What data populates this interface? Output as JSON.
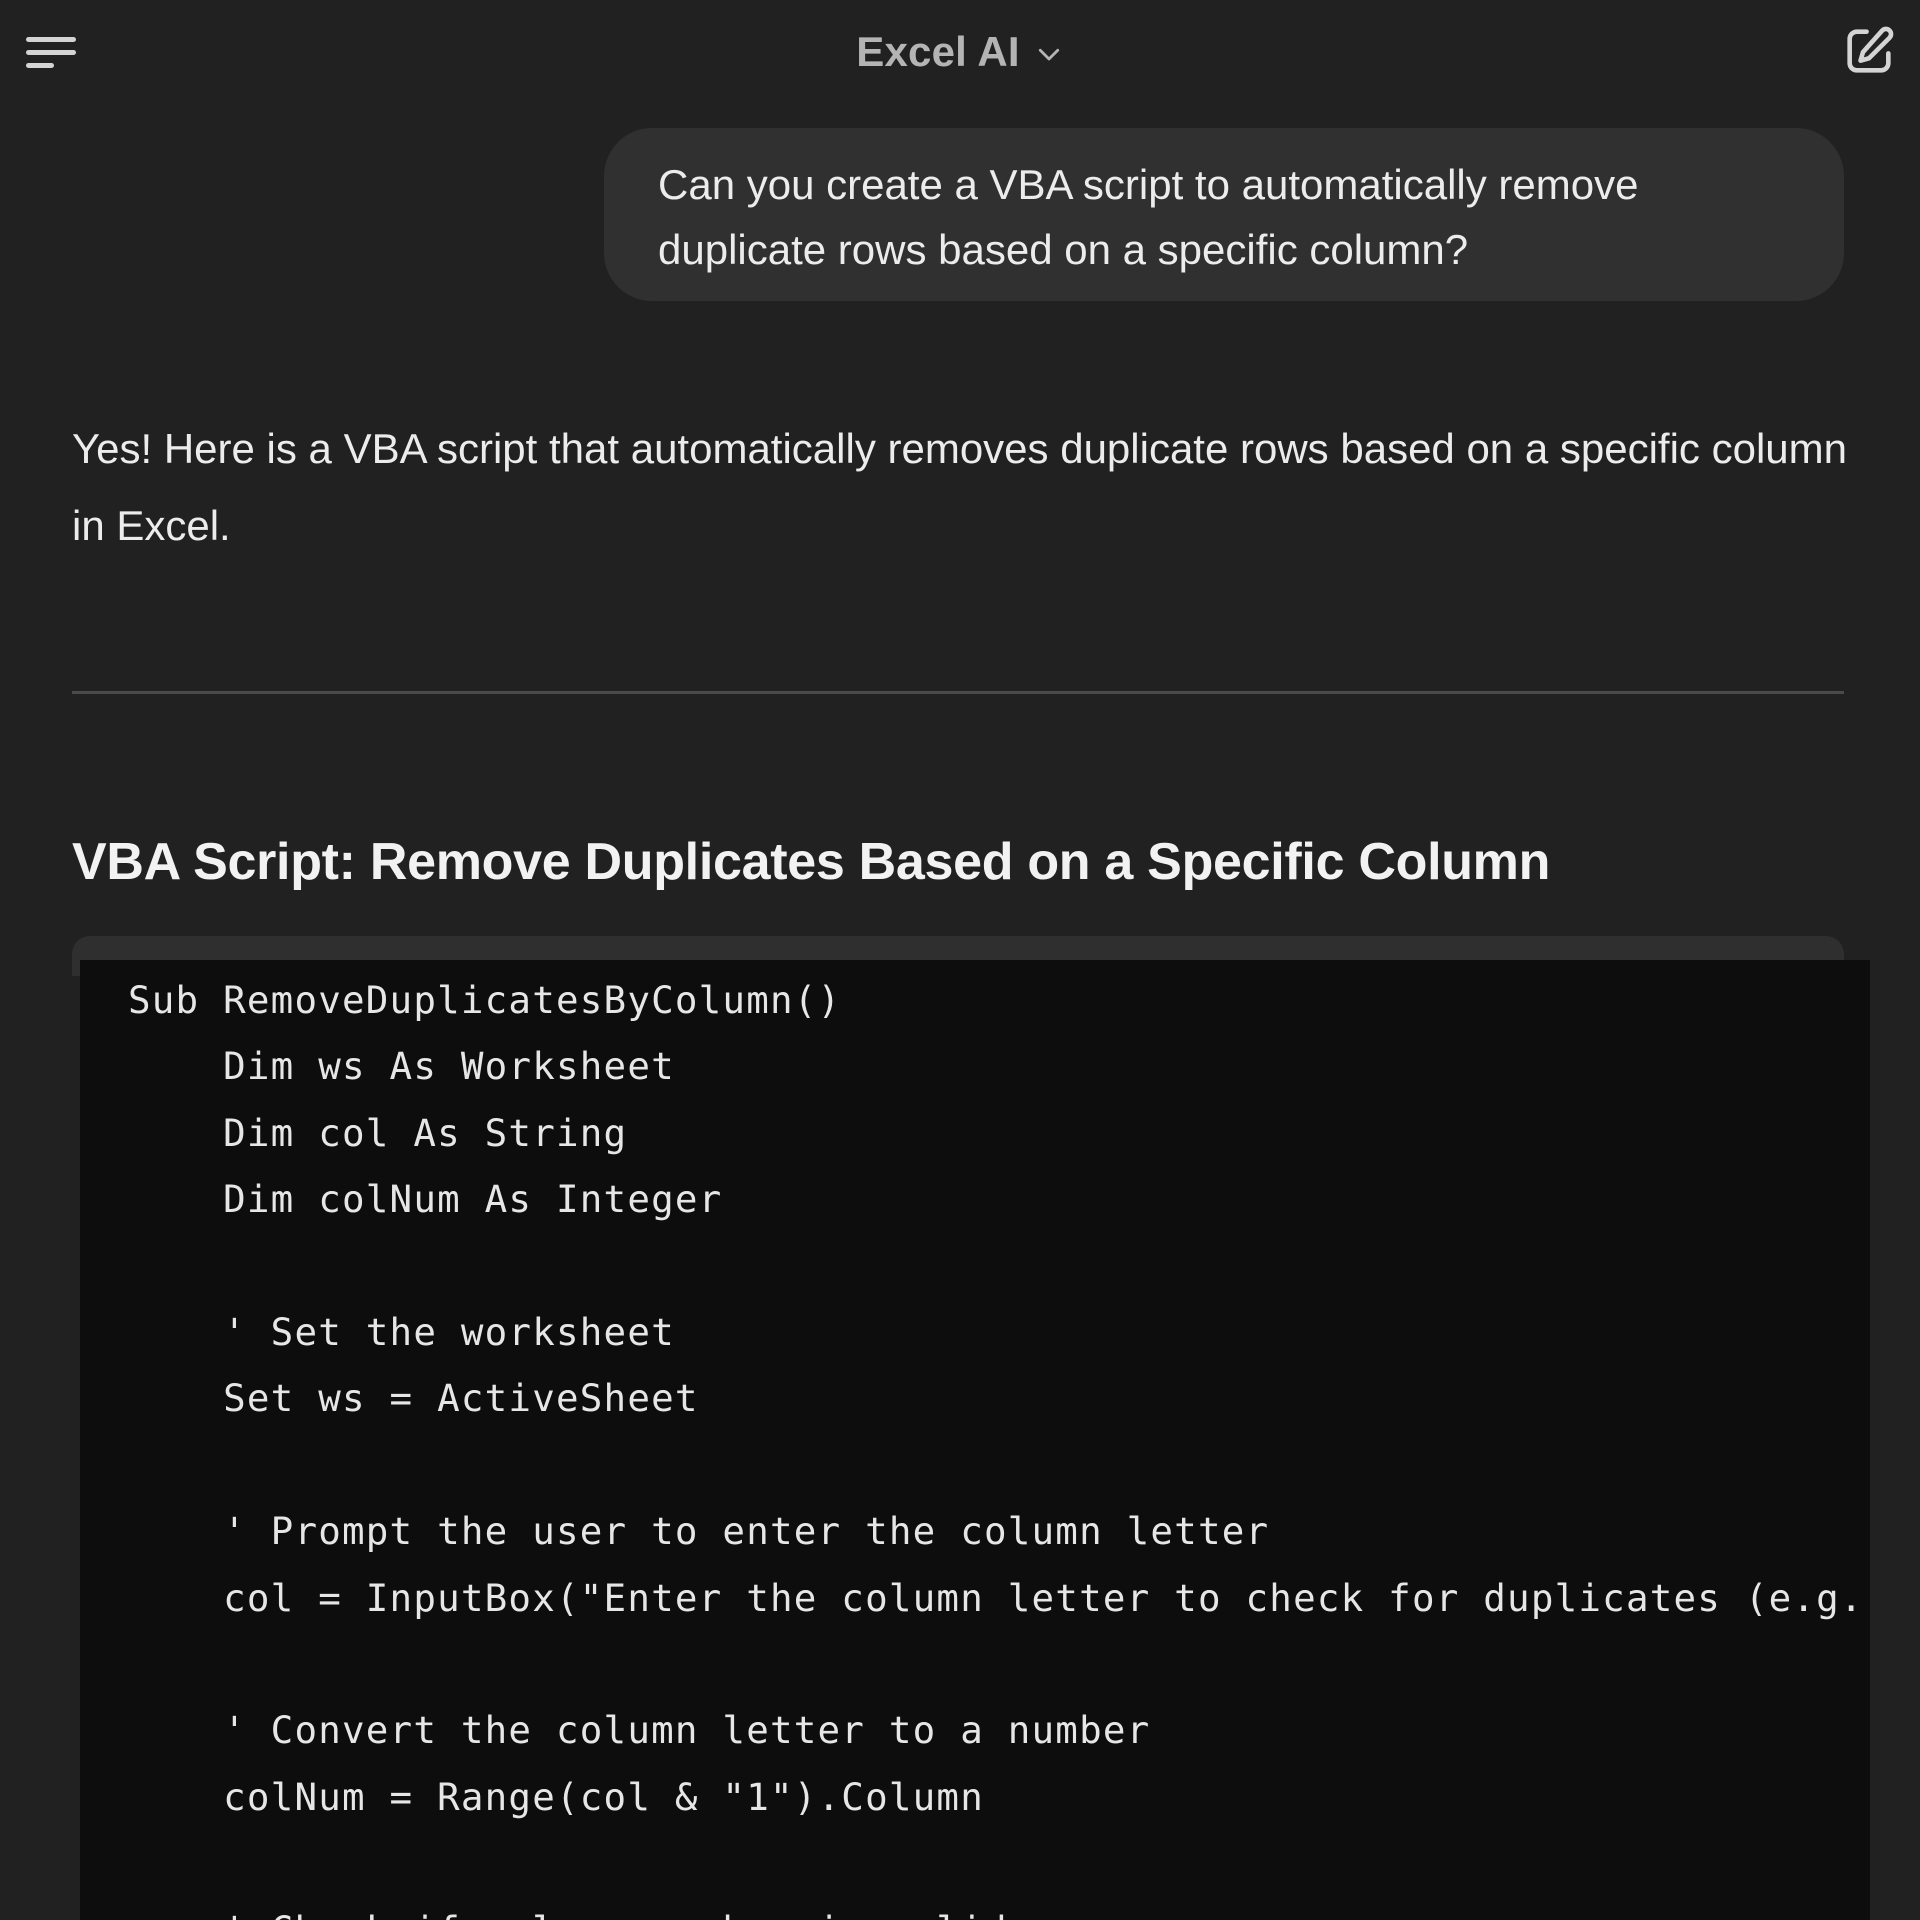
{
  "header": {
    "title": "Excel AI",
    "menu_icon": "hamburger-menu-icon",
    "dropdown_icon": "chevron-down-icon",
    "new_chat_icon": "edit-icon"
  },
  "conversation": {
    "user_message": "Can you create a VBA script to automatically remove duplicate rows based on a specific column?",
    "assistant_intro": "Yes! Here is a VBA script that automatically removes duplicate rows based on a specific column in Excel.",
    "section_heading": "VBA Script: Remove Duplicates Based on a Specific Column",
    "code_lines": [
      "Sub RemoveDuplicatesByColumn()",
      "    Dim ws As Worksheet",
      "    Dim col As String",
      "    Dim colNum As Integer",
      "",
      "    ' Set the worksheet",
      "    Set ws = ActiveSheet",
      "",
      "    ' Prompt the user to enter the column letter",
      "    col = InputBox(\"Enter the column letter to check for duplicates (e.g.",
      "",
      "    ' Convert the column letter to a number",
      "    colNum = Range(col & \"1\").Column",
      "",
      "    ' Check if column number is valid"
    ]
  },
  "colors": {
    "background": "#212121",
    "bubble": "#303030",
    "code_background": "#0d0d0d",
    "text": "#ececec"
  }
}
